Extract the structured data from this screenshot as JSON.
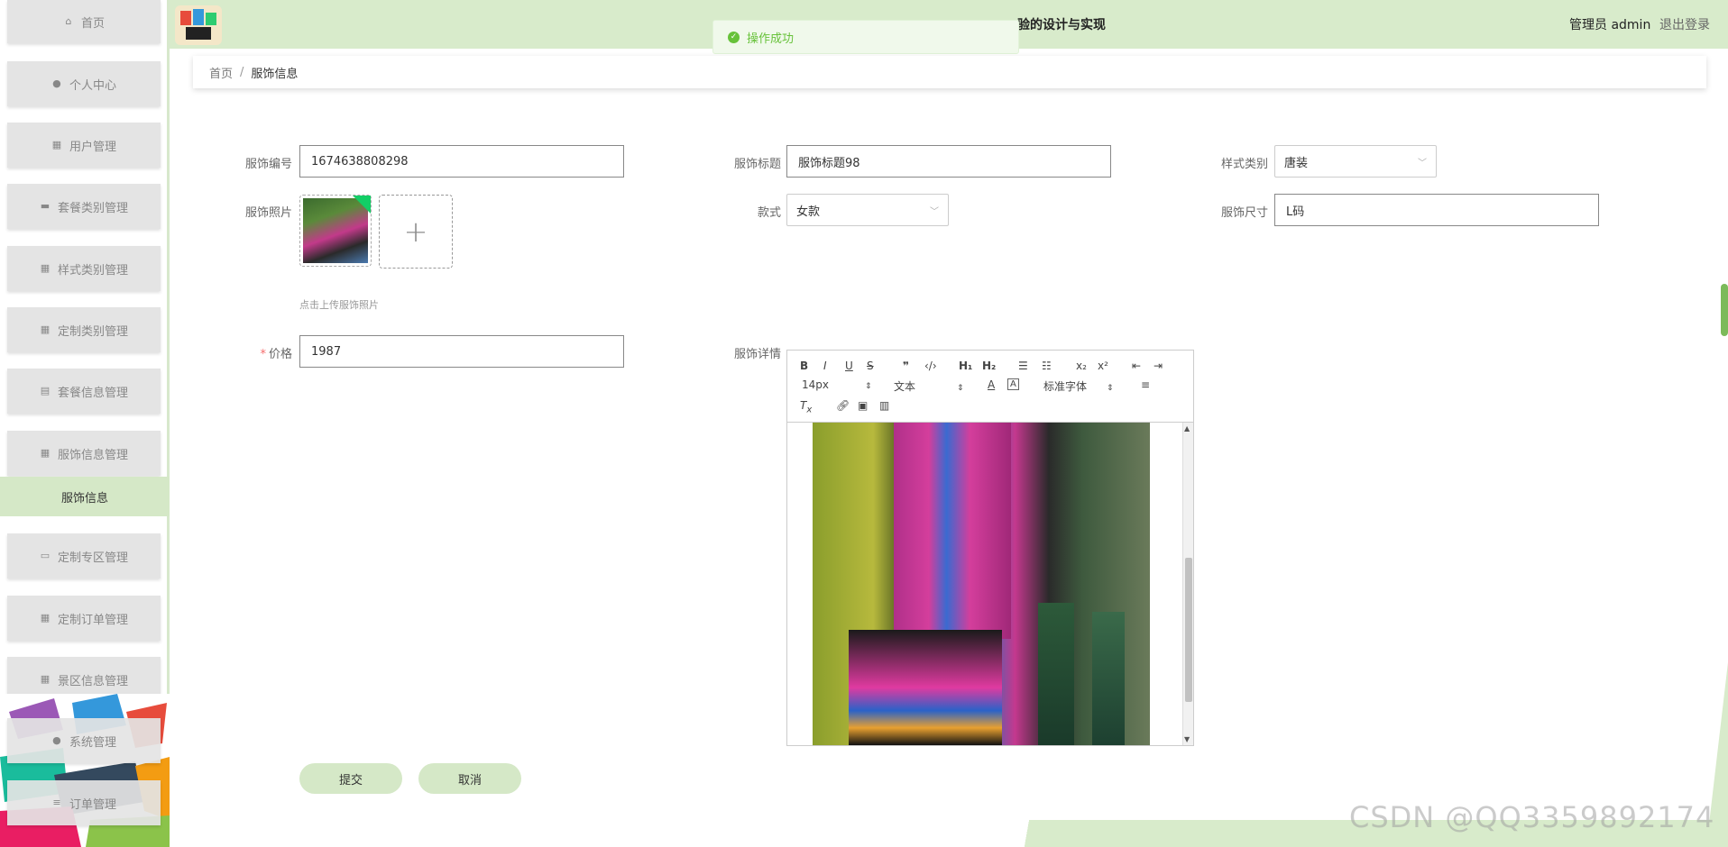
{
  "header": {
    "title": "...的设计与实现",
    "title_visible": "验的设计与实现",
    "admin_label": "管理员 admin",
    "logout_label": "退出登录"
  },
  "toast": {
    "message": "操作成功"
  },
  "breadcrumb": {
    "home": "首页",
    "separator": "/",
    "current": "服饰信息"
  },
  "sidebar": {
    "items": [
      {
        "label": "首页",
        "icon": "home-icon"
      },
      {
        "label": "个人中心",
        "icon": "user-icon"
      },
      {
        "label": "用户管理",
        "icon": "grid-icon"
      },
      {
        "label": "套餐类别管理",
        "icon": "briefcase-icon"
      },
      {
        "label": "样式类别管理",
        "icon": "grid-icon"
      },
      {
        "label": "定制类别管理",
        "icon": "grid-icon"
      },
      {
        "label": "套餐信息管理",
        "icon": "clipboard-icon"
      },
      {
        "label": "服饰信息管理",
        "icon": "grid-icon"
      },
      {
        "label": "定制专区管理",
        "icon": "monitor-icon"
      },
      {
        "label": "定制订单管理",
        "icon": "grid-icon"
      },
      {
        "label": "景区信息管理",
        "icon": "grid-icon"
      },
      {
        "label": "系统管理",
        "icon": "pin-icon"
      },
      {
        "label": "订单管理",
        "icon": "list-icon"
      }
    ],
    "active_sub": "服饰信息"
  },
  "form": {
    "code_label": "服饰编号",
    "code_value": "1674638808298",
    "title_label": "服饰标题",
    "title_value": "服饰标题98",
    "style_label": "样式类别",
    "style_value": "唐装",
    "photo_label": "服饰照片",
    "photo_tip": "点击上传服饰照片",
    "kind_label": "款式",
    "kind_value": "女款",
    "size_label": "服饰尺寸",
    "size_value": "L码",
    "price_required": "*",
    "price_label": "价格",
    "price_value": "1987",
    "detail_label": "服饰详情"
  },
  "editor": {
    "font_size": "14px",
    "block_type": "文本",
    "font_family": "标准字体"
  },
  "buttons": {
    "submit": "提交",
    "cancel": "取消"
  },
  "watermark": "CSDN @QQ3359892174"
}
